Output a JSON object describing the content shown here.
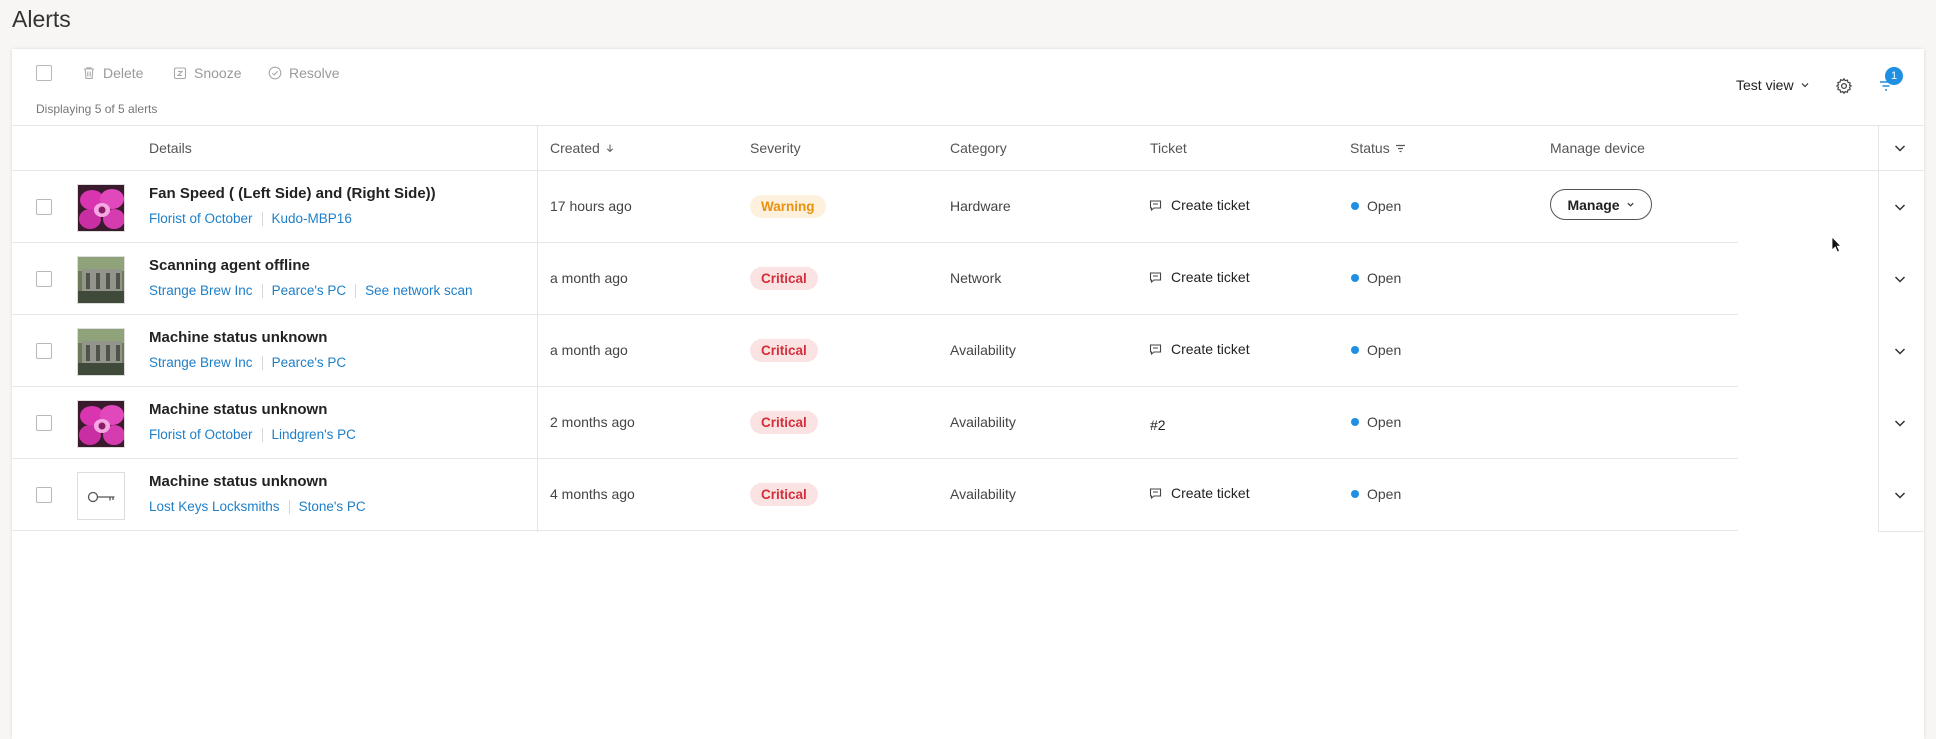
{
  "page": {
    "title": "Alerts"
  },
  "toolbar": {
    "actions": [
      {
        "label": "Delete",
        "icon": "trash-icon"
      },
      {
        "label": "Snooze",
        "icon": "snooze-icon"
      },
      {
        "label": "Resolve",
        "icon": "check-circle-icon"
      }
    ],
    "display_count": "Displaying 5 of 5 alerts",
    "view_label": "Test view",
    "filter_badge": "1"
  },
  "columns": {
    "details": "Details",
    "created": "Created",
    "severity": "Severity",
    "category": "Category",
    "ticket": "Ticket",
    "status": "Status",
    "manage": "Manage device"
  },
  "rows": [
    {
      "title": "Fan Speed ( (Left Side) and (Right Side))",
      "links": [
        "Florist of October",
        "Kudo-MBP16"
      ],
      "thumbnail": "orchid",
      "created": "17 hours ago",
      "severity": "Warning",
      "category": "Hardware",
      "ticket": "Create ticket",
      "status": "Open",
      "manage": "Manage"
    },
    {
      "title": "Scanning agent offline",
      "links": [
        "Strange Brew Inc",
        "Pearce's PC",
        "See network scan"
      ],
      "thumbnail": "ruins",
      "created": "a month ago",
      "severity": "Critical",
      "category": "Network",
      "ticket": "Create ticket",
      "status": "Open"
    },
    {
      "title": "Machine status unknown",
      "links": [
        "Strange Brew Inc",
        "Pearce's PC"
      ],
      "thumbnail": "ruins",
      "created": "a month ago",
      "severity": "Critical",
      "category": "Availability",
      "ticket": "Create ticket",
      "status": "Open"
    },
    {
      "title": "Machine status unknown",
      "links": [
        "Florist of October",
        "Lindgren's PC"
      ],
      "thumbnail": "orchid",
      "created": "2 months ago",
      "severity": "Critical",
      "category": "Availability",
      "ticket": "#2",
      "status": "Open"
    },
    {
      "title": "Machine status unknown",
      "links": [
        "Lost Keys Locksmiths",
        "Stone's PC"
      ],
      "thumbnail": "key",
      "created": "4 months ago",
      "severity": "Critical",
      "category": "Availability",
      "ticket": "Create ticket",
      "status": "Open"
    }
  ],
  "colors": {
    "link": "#1e7fc7",
    "warning": "#e8920f",
    "critical": "#d32f3b",
    "status_dot": "#1e8fe1"
  }
}
